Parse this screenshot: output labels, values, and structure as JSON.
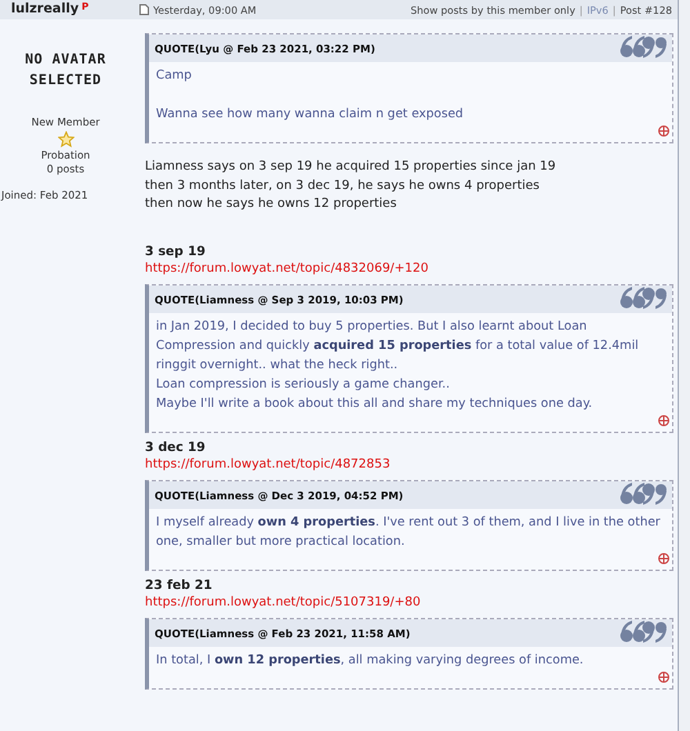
{
  "author": {
    "username": "lulzreally",
    "badge": "P",
    "avatar_text": [
      "NO AVATAR",
      "SELECTED"
    ],
    "rank": "New Member",
    "group": "Probation",
    "posts": "0 posts",
    "joined": "Joined: Feb 2021"
  },
  "post_header": {
    "date": "Yesterday, 09:00 AM",
    "show_posts": "Show posts by this member only",
    "separator": "|",
    "ip": "IPv6",
    "post_number": "Post #128"
  },
  "blocks": [
    {
      "kind": "quote",
      "title": "QUOTE(Lyu @ Feb 23 2021, 03:22 PM)",
      "paragraphs": [
        [
          "Camp"
        ],
        [
          "Wanna see how many wanna claim n get exposed"
        ]
      ]
    },
    {
      "kind": "text",
      "lines": [
        "Liamness says on 3 sep 19 he acquired 15 properties since jan 19",
        "then 3 months later, on 3 dec 19, he says he owns 4 properties",
        "then now he says he owns 12 properties"
      ]
    },
    {
      "kind": "heading",
      "text": "3 sep 19"
    },
    {
      "kind": "link",
      "text": "https://forum.lowyat.net/topic/4832069/+120"
    },
    {
      "kind": "quote",
      "title": "QUOTE(Liamness @ Sep 3 2019, 10:03 PM)",
      "paragraphs": [
        [
          "in Jan 2019, I decided to buy 5 properties. But I also learnt about Loan Compression and quickly **acquired 15 properties** for a total value of 12.4mil ringgit overnight.. what the heck right..",
          "Loan compression is seriously a game changer..",
          "Maybe I'll write a book about this all and share my techniques one day."
        ]
      ]
    },
    {
      "kind": "heading",
      "text": "3 dec 19"
    },
    {
      "kind": "link",
      "text": "https://forum.lowyat.net/topic/4872853"
    },
    {
      "kind": "quote",
      "title": "QUOTE(Liamness @ Dec 3 2019, 04:52 PM)",
      "paragraphs": [
        [
          "I myself already **own 4 properties**. I've rent out 3 of them, and I live in the other one, smaller but more practical location."
        ]
      ]
    },
    {
      "kind": "heading",
      "text": "23 feb 21"
    },
    {
      "kind": "link",
      "text": "https://forum.lowyat.net/topic/5107319/+80"
    },
    {
      "kind": "quote",
      "title": "QUOTE(Liamness @ Feb 23 2021, 11:58 AM)",
      "paragraphs": [
        [
          "In total, I **own 12 properties**, all making varying degrees of income."
        ]
      ]
    }
  ]
}
